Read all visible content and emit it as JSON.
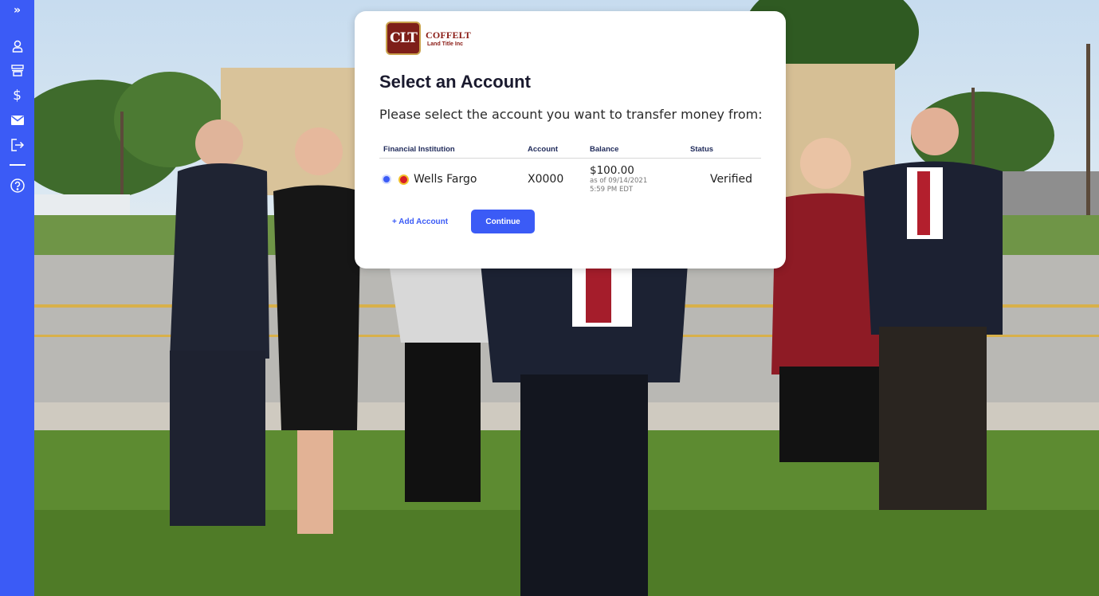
{
  "sidebar": {
    "items": [
      {
        "icon": "expand-icon",
        "glyph": "»"
      },
      {
        "icon": "user-icon"
      },
      {
        "icon": "bank-icon"
      },
      {
        "icon": "dollar-icon",
        "glyph": "$"
      },
      {
        "icon": "mail-icon"
      },
      {
        "icon": "logout-icon"
      },
      {
        "icon": "help-icon"
      }
    ],
    "color": "#3b5bf6"
  },
  "logo": {
    "mark": "CLT",
    "name": "COFFELT",
    "subname": "Land Title Inc"
  },
  "modal": {
    "title": "Select an Account",
    "subtitle": "Please select the account you want to transfer money from:",
    "table": {
      "headers": [
        "Financial Institution",
        "Account",
        "Balance",
        "Status"
      ],
      "rows": [
        {
          "selected": true,
          "institution": "Wells Fargo",
          "account": "X0000",
          "balance": "$100.00",
          "balance_date": "as of 09/14/2021",
          "balance_time": "5:59 PM EDT",
          "status": "Verified"
        }
      ]
    },
    "add_account_label": "+ Add Account",
    "continue_label": "Continue"
  },
  "colors": {
    "accent": "#3b5bf6",
    "brand": "#8a1a14"
  }
}
